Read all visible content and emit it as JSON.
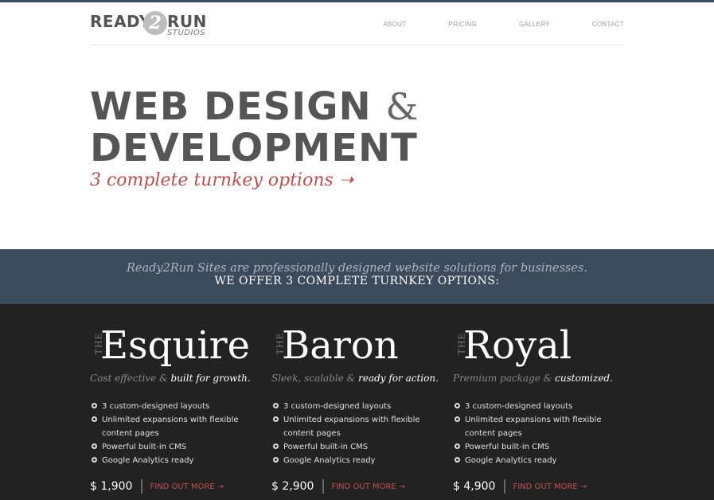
{
  "brand": {
    "word1": "READY",
    "circle": "2",
    "word2": "RUN",
    "sub": "STUDIOS"
  },
  "nav": [
    {
      "label": "ABOUT"
    },
    {
      "label": "PRICING"
    },
    {
      "label": "GALLERY"
    },
    {
      "label": "CONTACT"
    }
  ],
  "hero": {
    "line1": "WEB DESIGN",
    "amp": "&",
    "line2": "DEVELOPMENT",
    "tagline": "3 complete turnkey options ➝"
  },
  "band": {
    "line1": "Ready2Run Sites are professionally designed website solutions for businesses.",
    "line2": "WE OFFER 3 COMPLETE TURNKEY OPTIONS:"
  },
  "packages": [
    {
      "the": "THE",
      "name": "Esquire",
      "desc_plain": "Cost effective & ",
      "desc_em": "built for growth.",
      "features": [
        "3 custom-designed layouts",
        "Unlimited expansions with flexible content pages",
        "Powerful built-in CMS",
        "Google Analytics ready"
      ],
      "price": "$ 1,900",
      "cta": "FIND OUT MORE →"
    },
    {
      "the": "THE",
      "name": "Baron",
      "desc_plain": "Sleek, scalable & ",
      "desc_em": "ready for action.",
      "features": [
        "3 custom-designed layouts",
        "Unlimited expansions with flexible content pages",
        "Powerful built-in CMS",
        "Google Analytics ready"
      ],
      "price": "$ 2,900",
      "cta": "FIND OUT MORE →"
    },
    {
      "the": "THE",
      "name": "Royal",
      "desc_plain": "Premium package & ",
      "desc_em": "customized.",
      "features": [
        "3 custom-designed layouts",
        "Unlimited expansions with flexible content pages",
        "Powerful built-in CMS",
        "Google Analytics ready"
      ],
      "price": "$ 4,900",
      "cta": "FIND OUT MORE →"
    }
  ],
  "colors": {
    "accent": "#c0504d",
    "band": "#3b4b5c",
    "dark": "#222222",
    "heading": "#555555"
  }
}
